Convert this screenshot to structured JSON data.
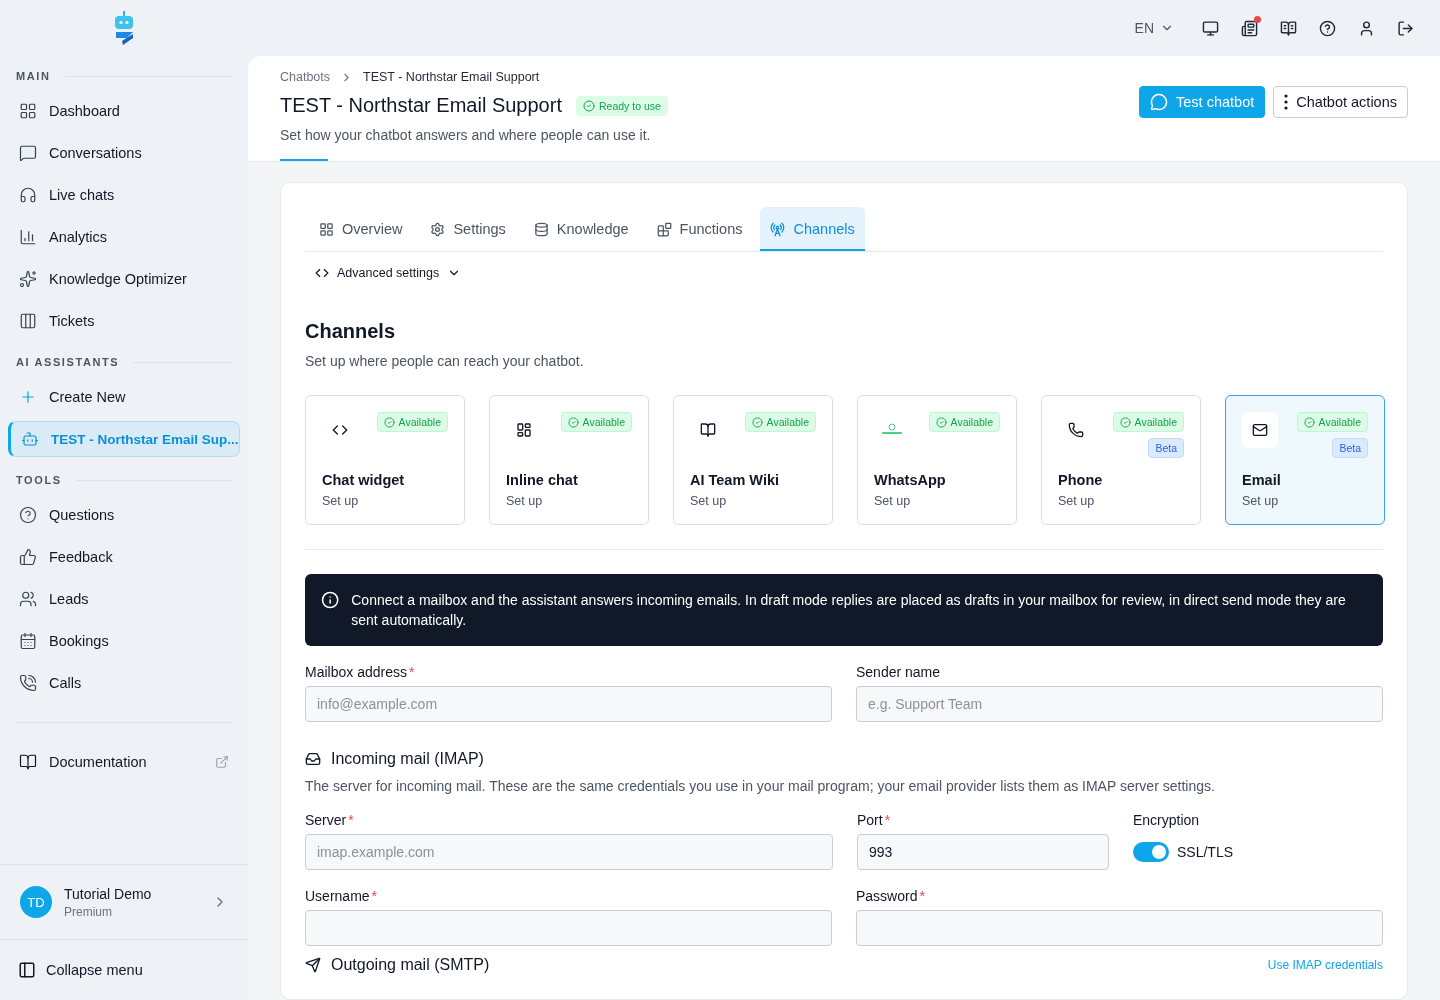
{
  "topbar": {
    "language": "EN",
    "notification_unread": true
  },
  "sidebar": {
    "sections": [
      {
        "title": "MAIN",
        "items": [
          {
            "label": "Dashboard",
            "selected": false
          },
          {
            "label": "Conversations",
            "selected": false
          },
          {
            "label": "Live chats",
            "selected": false
          },
          {
            "label": "Analytics",
            "selected": false
          },
          {
            "label": "Knowledge Optimizer",
            "selected": false
          },
          {
            "label": "Tickets",
            "selected": false
          }
        ]
      },
      {
        "title": "AI ASSISTANTS",
        "items": [
          {
            "label": "Create New",
            "selected": false
          },
          {
            "label": "TEST - Northstar Email Sup...",
            "selected": true
          }
        ]
      },
      {
        "title": "TOOLS",
        "items": [
          {
            "label": "Questions",
            "selected": false
          },
          {
            "label": "Feedback",
            "selected": false
          },
          {
            "label": "Leads",
            "selected": false
          },
          {
            "label": "Bookings",
            "selected": false
          },
          {
            "label": "Calls",
            "selected": false
          }
        ]
      }
    ],
    "documentation": "Documentation",
    "user": {
      "initials": "TD",
      "name": "Tutorial Demo",
      "plan": "Premium"
    },
    "collapse": "Collapse menu"
  },
  "breadcrumb": [
    "Chatbots",
    "TEST - Northstar Email Support"
  ],
  "title": "TEST - Northstar Email Support",
  "status": "Ready to use",
  "subtitle": "Set how your chatbot answers and where people can use it.",
  "actions": [
    {
      "label": "Test chatbot",
      "kind": "primary"
    },
    {
      "label": "Chatbot actions",
      "kind": "secondary"
    }
  ],
  "tabs": [
    {
      "label": "Overview",
      "selected": false
    },
    {
      "label": "Settings",
      "selected": false
    },
    {
      "label": "Knowledge",
      "selected": false
    },
    {
      "label": "Functions",
      "selected": false
    },
    {
      "label": "Channels",
      "selected": true
    }
  ],
  "advanced_settings": "Advanced settings",
  "channels": {
    "heading": "Channels",
    "description": "Set up where people can reach your chatbot.",
    "cards": [
      {
        "name": "Chat widget",
        "action": "Set up",
        "badges": [
          "Available"
        ],
        "selected": false
      },
      {
        "name": "Inline chat",
        "action": "Set up",
        "badges": [
          "Available"
        ],
        "selected": false
      },
      {
        "name": "AI Team Wiki",
        "action": "Set up",
        "badges": [
          "Available"
        ],
        "selected": false
      },
      {
        "name": "WhatsApp",
        "action": "Set up",
        "badges": [
          "Available"
        ],
        "selected": false
      },
      {
        "name": "Phone",
        "action": "Set up",
        "badges": [
          "Available",
          "Beta"
        ],
        "selected": false
      },
      {
        "name": "Email",
        "action": "Set up",
        "badges": [
          "Available",
          "Beta"
        ],
        "selected": true
      }
    ]
  },
  "notice": "Connect a mailbox and the assistant answers incoming emails. In draft mode replies are placed as drafts in your mailbox for review, in direct send mode they are sent automatically.",
  "required_mark": "*",
  "mailbox_fields": [
    {
      "label": "Mailbox address",
      "required": true,
      "placeholder": "info@example.com"
    },
    {
      "label": "Sender name",
      "required": false,
      "placeholder": "e.g. Support Team"
    }
  ],
  "imap": {
    "heading": "Incoming mail (IMAP)",
    "description": "The server for incoming mail. These are the same credentials you use in your mail program; your email provider lists them as IMAP server settings.",
    "server": {
      "label": "Server",
      "required": true,
      "placeholder": "imap.example.com"
    },
    "port": {
      "label": "Port",
      "required": true,
      "value": "993"
    },
    "encryption": {
      "label": "Encryption",
      "on": true,
      "option": "SSL/TLS"
    },
    "credentials": [
      {
        "label": "Username",
        "required": true
      },
      {
        "label": "Password",
        "required": true
      }
    ]
  },
  "smtp": {
    "heading": "Outgoing mail (SMTP)",
    "link": "Use IMAP credentials"
  }
}
